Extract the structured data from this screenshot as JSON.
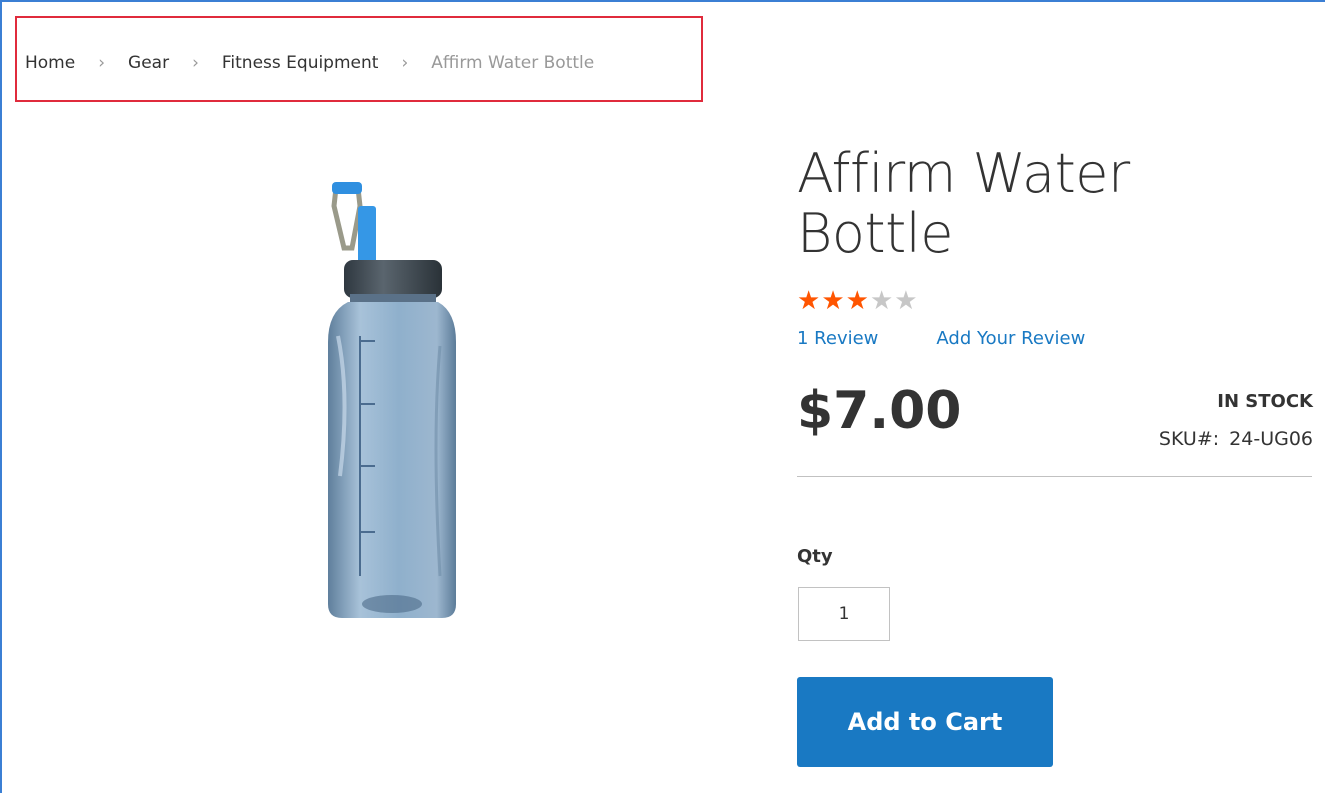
{
  "breadcrumb": {
    "items": [
      {
        "label": "Home"
      },
      {
        "label": "Gear"
      },
      {
        "label": "Fitness Equipment"
      },
      {
        "label": "Affirm Water Bottle"
      }
    ],
    "separator": "›",
    "highlight_color": "#e02b3c"
  },
  "product": {
    "title": "Affirm Water Bottle",
    "image": "water-bottle-image",
    "rating": {
      "stars_filled": 3,
      "stars_total": 5,
      "star_filled_char": "★",
      "star_empty_char": "★",
      "color": "#ff5501"
    },
    "review_count_label": "1 Review",
    "add_review_label": "Add Your Review",
    "price": "$7.00",
    "stock_status": "IN STOCK",
    "sku_label": "SKU#:",
    "sku_value": "24-UG06",
    "qty_label": "Qty",
    "qty_value": "1",
    "add_to_cart_label": "Add to Cart",
    "accent_color": "#1979c3"
  }
}
